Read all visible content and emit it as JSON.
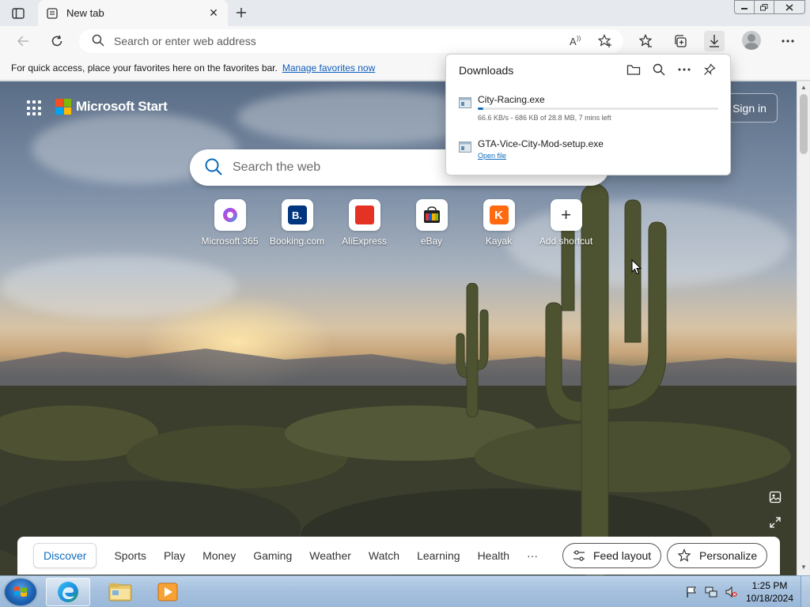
{
  "browser": {
    "tab": {
      "title": "New tab"
    },
    "address_bar": {
      "placeholder": "Search or enter web address"
    },
    "favorites_bar": {
      "message": "For quick access, place your favorites here on the favorites bar.",
      "link": "Manage favorites now"
    }
  },
  "downloads": {
    "title": "Downloads",
    "items": [
      {
        "name": "City-Racing.exe",
        "status": "66.6 KB/s - 686 KB of 28.8 MB, 7 mins left",
        "progress": 0.024
      },
      {
        "name": "GTA-Vice-City-Mod-setup.exe",
        "action": "Open file"
      }
    ]
  },
  "new_tab_page": {
    "brand": "Microsoft Start",
    "sign_in": "Sign in",
    "search_placeholder": "Search the web",
    "shortcuts": [
      {
        "label": "Microsoft 365",
        "icon": "microsoft365-icon"
      },
      {
        "label": "Booking.com",
        "icon": "booking-icon",
        "glyph": "B."
      },
      {
        "label": "AliExpress",
        "icon": "aliexpress-icon"
      },
      {
        "label": "eBay",
        "icon": "ebay-icon"
      },
      {
        "label": "Kayak",
        "icon": "kayak-icon",
        "glyph": "K"
      },
      {
        "label": "Add shortcut",
        "icon": "plus-icon",
        "glyph": "+"
      }
    ],
    "feed_tabs": [
      "Discover",
      "Sports",
      "Play",
      "Money",
      "Gaming",
      "Weather",
      "Watch",
      "Learning",
      "Health"
    ],
    "feed_more": "···",
    "feed_layout": "Feed layout",
    "personalize": "Personalize"
  },
  "taskbar": {
    "time": "1:25 PM",
    "date": "10/18/2024"
  },
  "colors": {
    "accent": "#0f6cbd",
    "link": "#0f5cbf"
  }
}
